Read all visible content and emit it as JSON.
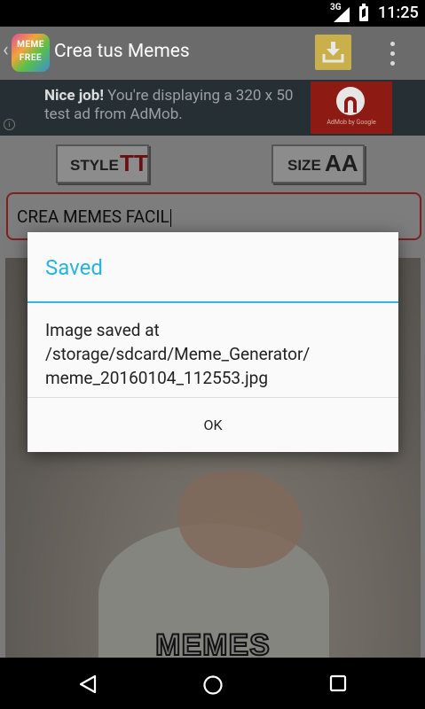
{
  "status_bar": {
    "network": "3G",
    "time": "11:25"
  },
  "app_bar": {
    "logo_line1": "MEME",
    "logo_line2": "FREE",
    "title": "Crea tus Memes",
    "icons": [
      "back-icon",
      "download-icon",
      "overflow-menu-icon"
    ]
  },
  "ad": {
    "text_bold": "Nice job!",
    "text_rest": " You're displaying a 320 x 50 test ad from AdMob.",
    "badge_caption": "AdMob by Google",
    "info": "i"
  },
  "toolbar": {
    "style_label": "STYLE",
    "style_glyph": "TT",
    "size_label": "SIZE",
    "size_glyph": "AA"
  },
  "editor": {
    "text_value": "CREA MEMES FACIL"
  },
  "meme": {
    "caption": "MEMES"
  },
  "dialog": {
    "title": "Saved",
    "message": "Image saved at /storage/sdcard/Meme_Generator/ meme_20160104_112553.jpg",
    "ok_label": "OK",
    "title_color": "#29b4d9"
  },
  "nav_bar": {
    "icons": [
      "back-triangle-icon",
      "home-circle-icon",
      "recents-square-icon"
    ]
  }
}
